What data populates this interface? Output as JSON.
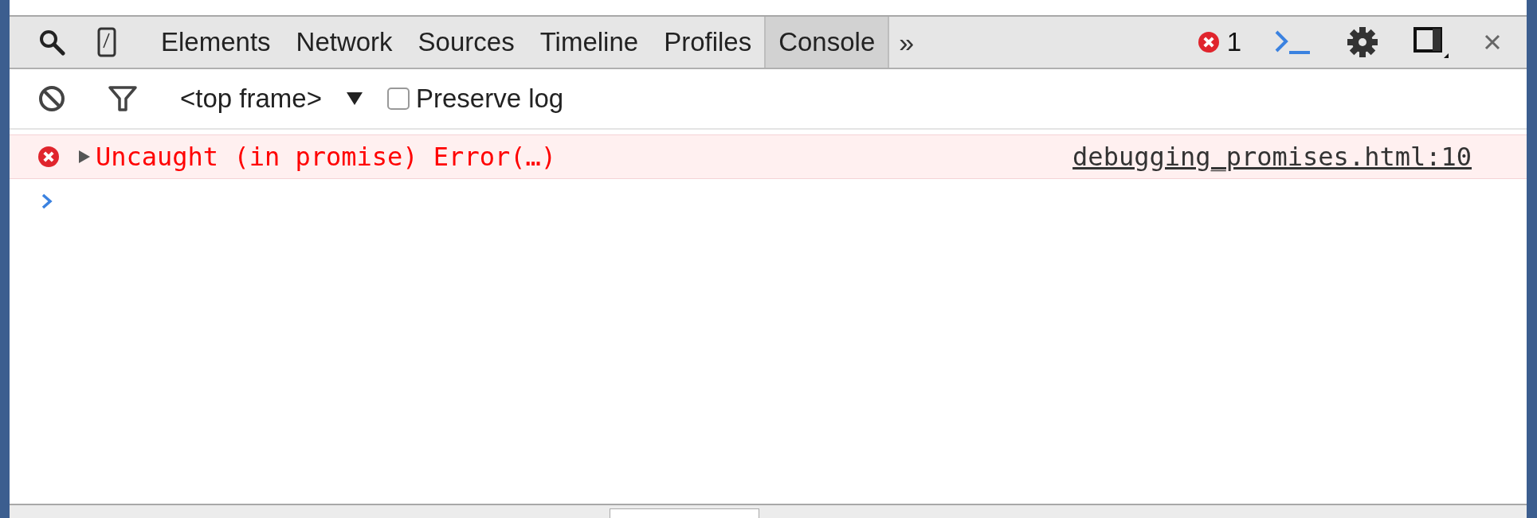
{
  "toolbar": {
    "tabs": [
      {
        "label": "Elements",
        "selected": false
      },
      {
        "label": "Network",
        "selected": false
      },
      {
        "label": "Sources",
        "selected": false
      },
      {
        "label": "Timeline",
        "selected": false
      },
      {
        "label": "Profiles",
        "selected": false
      },
      {
        "label": "Console",
        "selected": true
      }
    ],
    "more": "»",
    "error_count": "1"
  },
  "filter_bar": {
    "frame": "<top frame>",
    "preserve_log": {
      "label": "Preserve log",
      "checked": false
    }
  },
  "messages": [
    {
      "kind": "error",
      "text": "Uncaught (in promise) Error(…)",
      "source": "debugging_promises.html:10",
      "expanded": false
    }
  ]
}
